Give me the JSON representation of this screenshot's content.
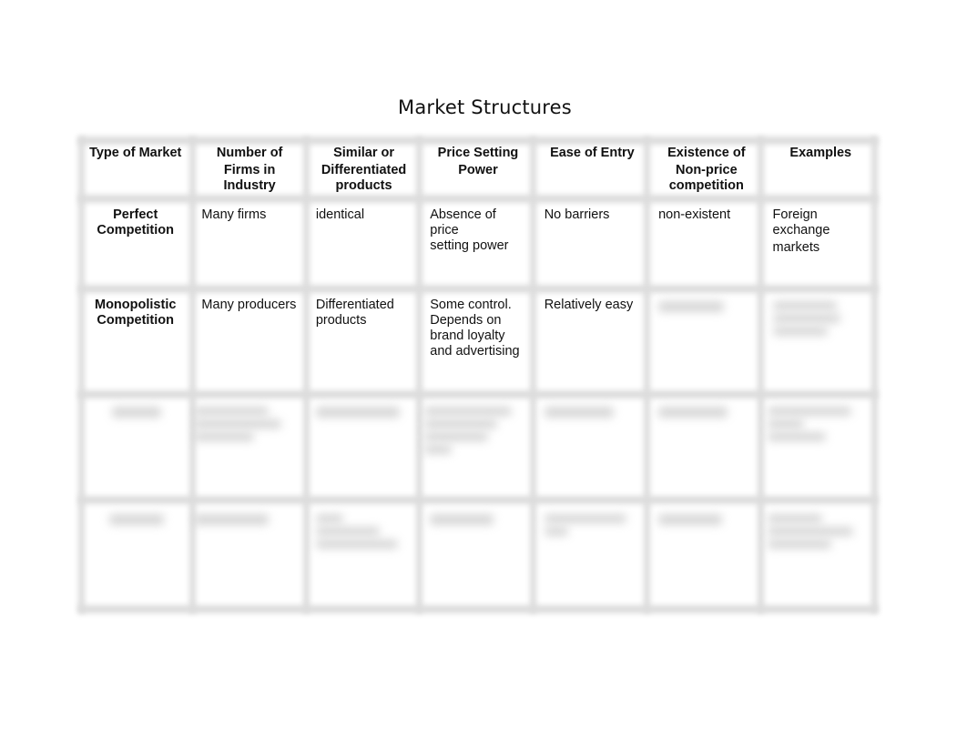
{
  "document": {
    "title": "Market Structures"
  },
  "table": {
    "headers": [
      {
        "line1": "Type of Market",
        "line2": "",
        "line3": ""
      },
      {
        "line1": "Number of",
        "line2": "Firms in",
        "line3": "Industry"
      },
      {
        "line1": "Similar or",
        "line2": "Differentiated",
        "line3": "products"
      },
      {
        "line1": "Price Setting",
        "line2": "Power",
        "line3": ""
      },
      {
        "line1": "Ease of Entry",
        "line2": "",
        "line3": ""
      },
      {
        "line1": "Existence of",
        "line2": "Non-price",
        "line3": "competition"
      },
      {
        "line1": "Examples",
        "line2": "",
        "line3": ""
      }
    ],
    "rows": [
      {
        "type": [
          "Perfect",
          "Competition"
        ],
        "firms": [
          "Many firms"
        ],
        "products": [
          "identical"
        ],
        "price_power": [
          "Absence of price",
          "setting power"
        ],
        "entry": [
          "No barriers"
        ],
        "non_price": [
          "non-existent"
        ],
        "examples": [
          "Foreign",
          "exchange",
          "markets"
        ]
      },
      {
        "type": [
          "Monopolistic",
          "Competition"
        ],
        "firms": [
          "Many producers"
        ],
        "products": [
          "Differentiated",
          "products"
        ],
        "price_power": [
          "Some control.",
          "Depends on",
          "brand loyalty",
          "and advertising"
        ],
        "entry": [
          "Relatively easy"
        ],
        "non_price": "[obscured]",
        "examples": "[obscured]"
      },
      {
        "type": "[obscured]",
        "firms": "[obscured]",
        "products": "[obscured]",
        "price_power": "[obscured]",
        "entry": "[obscured]",
        "non_price": "[obscured]",
        "examples": "[obscured]"
      },
      {
        "type": "[obscured]",
        "firms": "[obscured]",
        "products": "[obscured]",
        "price_power": "[obscured]",
        "entry": "[obscured]",
        "non_price": "[obscured]",
        "examples": "[obscured]"
      }
    ]
  }
}
